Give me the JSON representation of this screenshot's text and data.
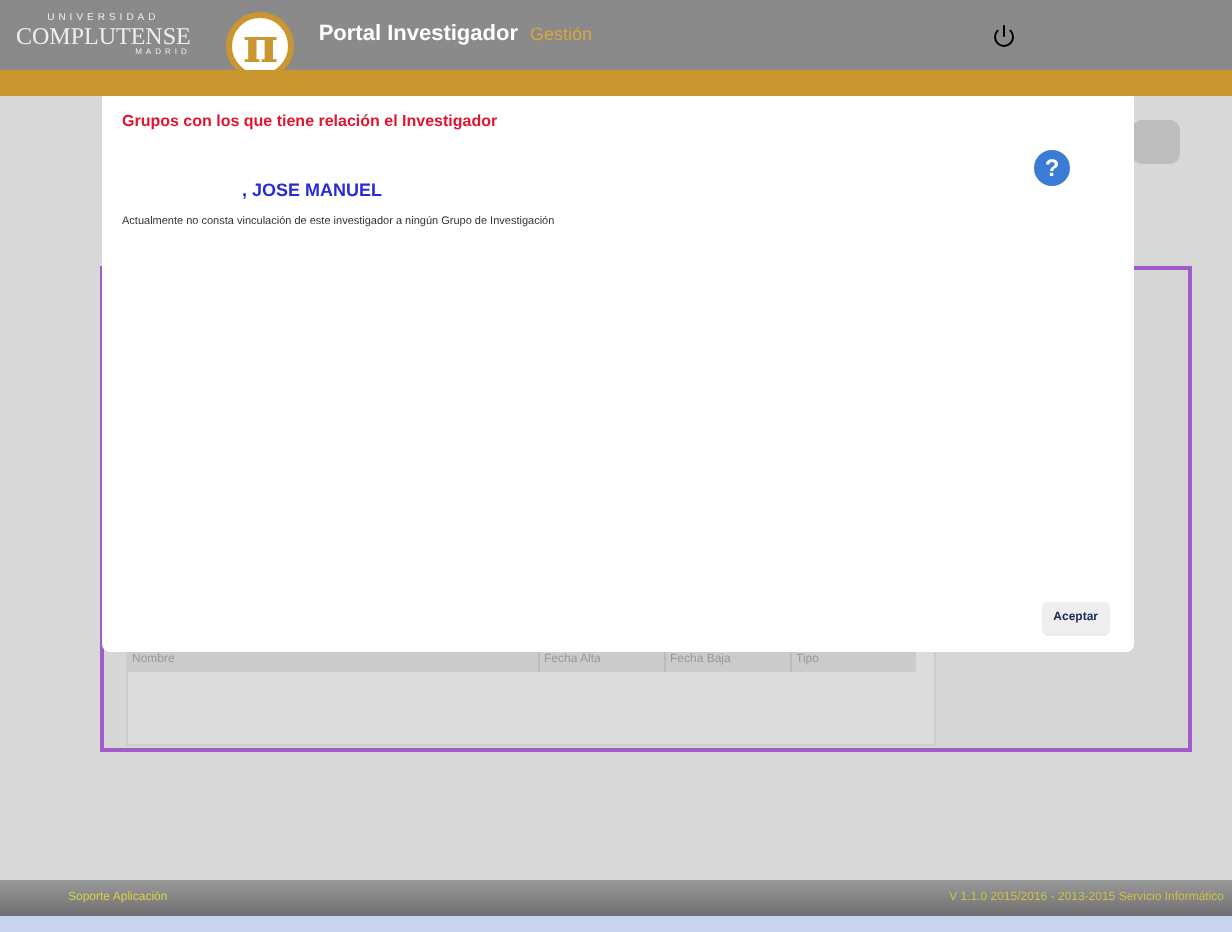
{
  "header": {
    "logo_top": "UNIVERSIDAD",
    "logo_main": "COMPLUTENSE",
    "logo_bottom": "MADRID",
    "logo_symbol": "π",
    "title": "Portal Investigador",
    "subtitle": "Gestión"
  },
  "background_table": {
    "columns": [
      "Nombre",
      "Fecha Alta",
      "Fecha Baja",
      "Tipo"
    ]
  },
  "dialog": {
    "title": "Grupos con los que tiene relación el Investigador",
    "name": ", JOSE MANUEL",
    "message": "Actualmente no consta vinculación de este investigador a ningún Grupo de Investigación",
    "help": "?",
    "button": "Aceptar"
  },
  "footer": {
    "left": "Soporte Aplicación",
    "right": "V 1.1.0 2015/2016 - 2013-2015 Servicio Informático"
  }
}
